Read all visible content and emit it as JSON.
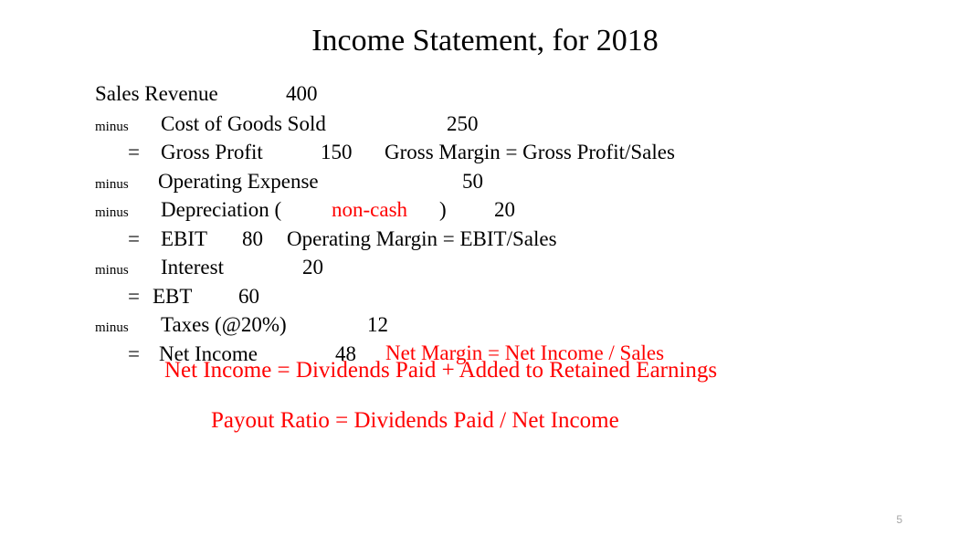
{
  "slide": {
    "title": "Income Statement, for 2018",
    "page_number": "5",
    "background_color": "#ffffff",
    "accent_color": "#ff0000",
    "text_color": "#000000"
  },
  "statement": {
    "rows": [
      {
        "operator": "",
        "label": "Sales Revenue",
        "amount": "400",
        "formula": "",
        "formula_color": "#000000"
      },
      {
        "operator": "minus",
        "label": "Cost of Goods Sold",
        "amount": "250",
        "formula": "",
        "formula_color": "#000000"
      },
      {
        "operator": "=",
        "label": "Gross Profit",
        "amount": "150",
        "formula": "Gross Margin = Gross Profit/Sales",
        "formula_color": "#000000"
      },
      {
        "operator": "minus",
        "label": "Operating Expense",
        "amount": "50",
        "formula": "",
        "formula_color": "#000000"
      },
      {
        "operator": "minus",
        "label_part_1": "Depreciation (",
        "label_highlight": "non-cash",
        "label_part_2": ")",
        "amount": "20",
        "formula": "",
        "formula_color": "#000000"
      },
      {
        "operator": "=",
        "label": "EBIT",
        "amount": "80",
        "formula": "Operating Margin = EBIT/Sales",
        "formula_color": "#000000"
      },
      {
        "operator": "minus",
        "label": "Interest",
        "amount": "20",
        "formula": "",
        "formula_color": "#000000"
      },
      {
        "operator": "=",
        "label": "EBT",
        "amount": "60",
        "formula": "",
        "formula_color": "#000000"
      },
      {
        "operator": "minus",
        "label": "Taxes (@20%)",
        "amount": "12",
        "formula": "",
        "formula_color": "#000000"
      },
      {
        "operator": "=",
        "label": "Net Income",
        "amount": "48",
        "formula": "Net Margin = Net Income / Sales",
        "formula_color": "#ff0000"
      }
    ]
  },
  "notes": {
    "retained_earnings": "Net Income = Dividends Paid + Added to Retained Earnings",
    "payout_ratio": "Payout Ratio = Dividends Paid / Net Income"
  }
}
